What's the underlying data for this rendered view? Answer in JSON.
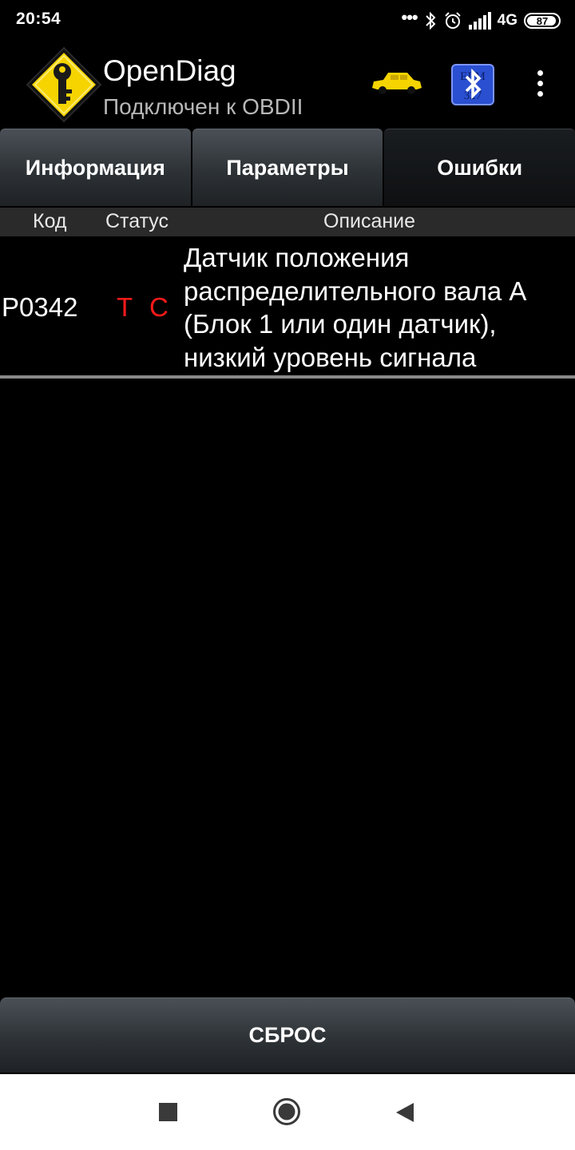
{
  "status_bar": {
    "time": "20:54",
    "dots": "•••",
    "network": "4G",
    "battery": "87",
    "icons": [
      "bluetooth-icon",
      "alarm-icon",
      "signal-icon",
      "battery-icon"
    ]
  },
  "app": {
    "title": "OpenDiag",
    "subtitle": "Подключен к OBDII",
    "car_color": "#f5d400",
    "icons": [
      "key-logo-icon",
      "car-icon",
      "bluetooth-elm327-icon",
      "more-vert-icon"
    ]
  },
  "tabs": [
    {
      "label": "Информация",
      "active": false
    },
    {
      "label": "Параметры",
      "active": false
    },
    {
      "label": "Ошибки",
      "active": true
    }
  ],
  "table": {
    "headers": {
      "code": "Код",
      "status": "Статус",
      "description": "Описание"
    },
    "rows": [
      {
        "code": "P0342",
        "status": [
          "T",
          "C"
        ],
        "description": "Датчик положения распределительного вала А (Блок 1 или один датчик), низкий уровень сигнала"
      }
    ]
  },
  "reset_button": "СБРОС",
  "nav": [
    "recents-icon",
    "home-icon",
    "back-icon"
  ],
  "colors": {
    "status_red": "#ff1a1a",
    "logo_yellow": "#f5d400",
    "bt_blue": "#2a4fd0"
  }
}
